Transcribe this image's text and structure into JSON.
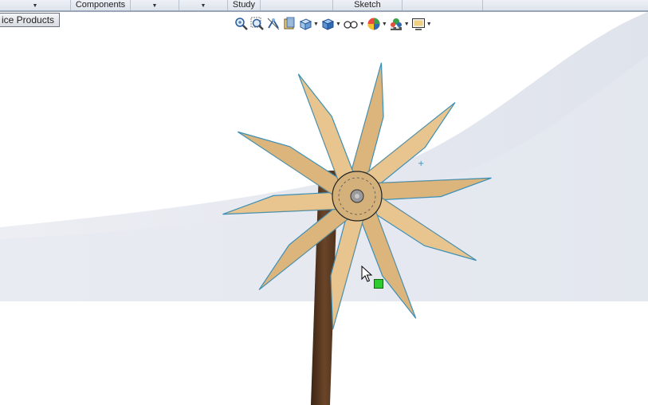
{
  "command_manager": {
    "tabs": [
      {
        "label": "",
        "has_dropdown": true
      },
      {
        "label": "Components",
        "has_dropdown": true
      },
      {
        "label": "",
        "has_dropdown": true
      },
      {
        "label": "Study",
        "has_dropdown": false
      },
      {
        "label": "",
        "has_dropdown": false
      },
      {
        "label": "Sketch",
        "has_dropdown": false
      },
      {
        "label": "",
        "has_dropdown": false
      }
    ]
  },
  "office_button": {
    "label": "ice Products"
  },
  "view_toolbar": {
    "items": [
      {
        "icon": "zoom-to-fit-icon",
        "has_dropdown": false
      },
      {
        "icon": "zoom-to-area-icon",
        "has_dropdown": false
      },
      {
        "icon": "previous-view-icon",
        "has_dropdown": false
      },
      {
        "icon": "section-view-icon",
        "has_dropdown": false
      },
      {
        "icon": "view-orientation-icon",
        "has_dropdown": true
      },
      {
        "icon": "display-style-icon",
        "has_dropdown": true
      },
      {
        "icon": "hide-show-items-icon",
        "has_dropdown": true
      },
      {
        "icon": "edit-appearance-icon",
        "has_dropdown": true
      },
      {
        "icon": "apply-scene-icon",
        "has_dropdown": true
      },
      {
        "icon": "view-settings-icon",
        "has_dropdown": true
      }
    ]
  },
  "model": {
    "name": "pinwheel",
    "blade_count": 10
  },
  "colors": {
    "blade_light": "#e8c48e",
    "blade_dark": "#b98f58",
    "blade_edge": "#3a8fb7",
    "stick": "#5a3a22",
    "hub": "#d4b07a",
    "background_shade": "#dfe3ec",
    "handle": "#2ecc2e"
  }
}
